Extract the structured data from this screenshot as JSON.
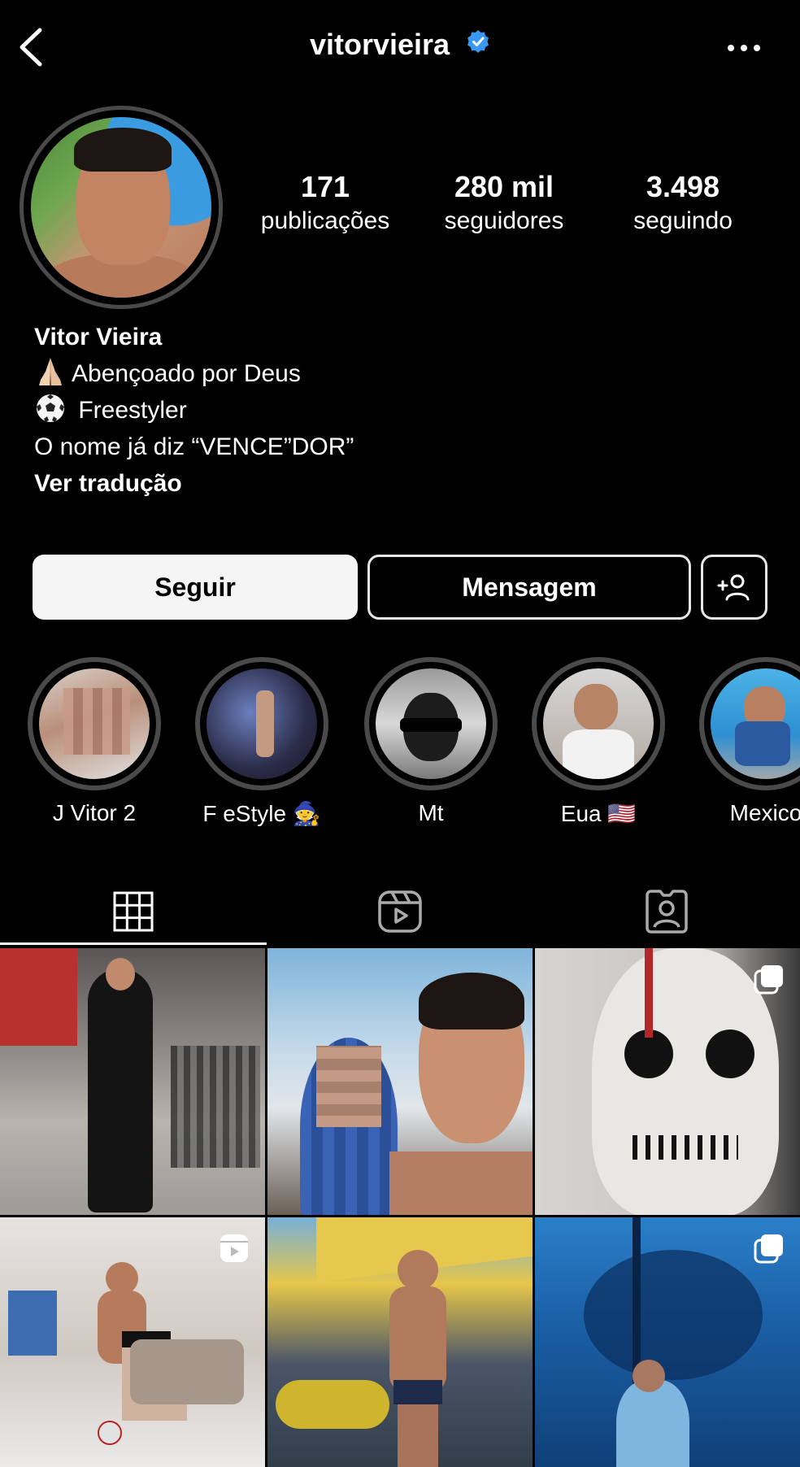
{
  "header": {
    "username": "vitorvieira",
    "verified": true
  },
  "stats": [
    {
      "num": "171",
      "label": "publicações"
    },
    {
      "num": "280 mil",
      "label": "seguidores"
    },
    {
      "num": "3.498",
      "label": "seguindo"
    }
  ],
  "bio": {
    "name": "Vitor Vieira",
    "line1": "Abençoado por Deus",
    "line2": "Freestyler",
    "line3": "O nome já diz “VENCE”DOR”",
    "translate": "Ver tradução"
  },
  "actions": {
    "follow": "Seguir",
    "message": "Mensagem"
  },
  "highlights": [
    {
      "label": "J Vitor 2"
    },
    {
      "label": "F  eStyle 🧙"
    },
    {
      "label": "Mt"
    },
    {
      "label": "Eua 🇺🇸"
    },
    {
      "label": "Mexico"
    }
  ],
  "tabs": [
    "grid-icon",
    "reels-icon",
    "tagged-icon"
  ],
  "colors": {
    "background": "#000000",
    "verified": "#3897f0",
    "ring": "#4a4a4a",
    "follow_bg": "#f5f5f5"
  }
}
